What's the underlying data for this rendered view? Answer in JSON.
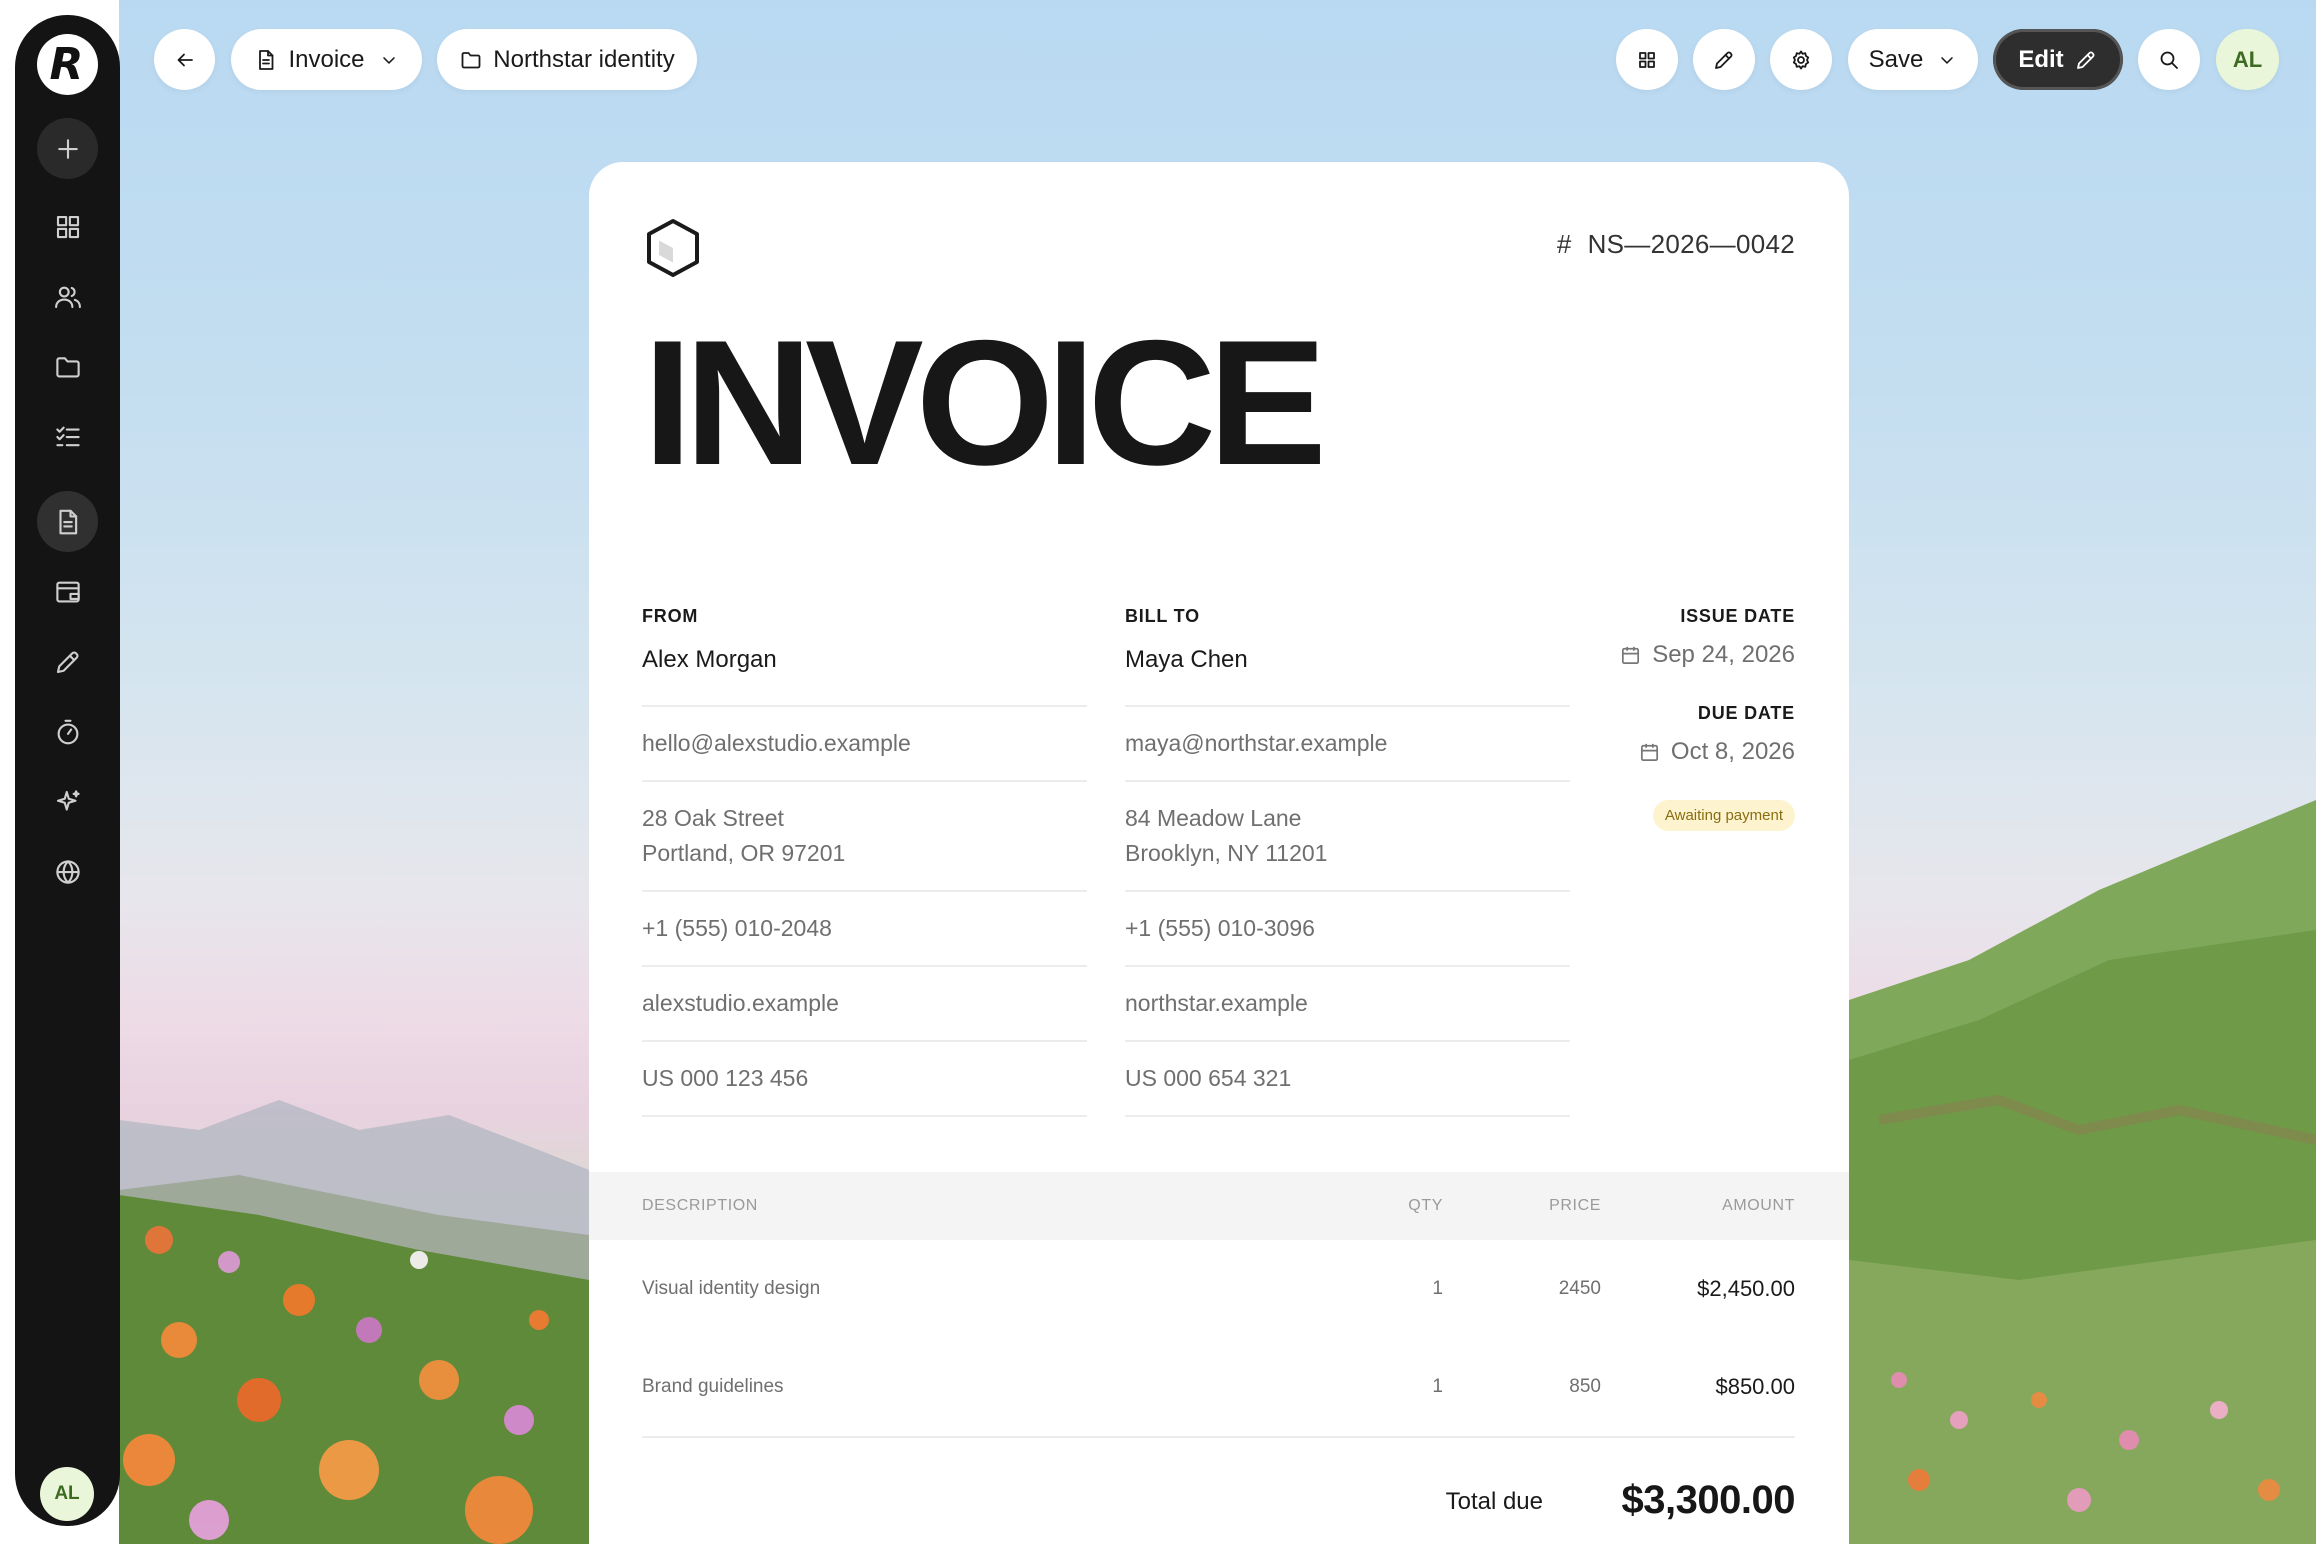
{
  "sidebar": {
    "logo_letter": "R",
    "avatar": "AL",
    "items": [
      {
        "icon": "plus-icon"
      },
      {
        "icon": "grid-icon"
      },
      {
        "icon": "users-icon"
      },
      {
        "icon": "folder-icon"
      },
      {
        "icon": "checklist-icon"
      },
      {
        "icon": "document-icon",
        "active": true
      },
      {
        "icon": "wallet-icon"
      },
      {
        "icon": "pencil-icon"
      },
      {
        "icon": "timer-icon"
      },
      {
        "icon": "sparkle-icon"
      },
      {
        "icon": "globe-icon"
      }
    ]
  },
  "topbar": {
    "doc_type": "Invoice",
    "project": "Northstar identity",
    "save_label": "Save",
    "edit_label": "Edit",
    "avatar": "AL"
  },
  "invoice": {
    "number_prefix": "#",
    "number": "NS—2026—0042",
    "title": "INVOICE",
    "from": {
      "label": "FROM",
      "name": "Alex Morgan",
      "email": "hello@alexstudio.example",
      "address_line1": "28 Oak Street",
      "address_line2": "Portland, OR 97201",
      "phone": "+1 (555) 010-2048",
      "website": "alexstudio.example",
      "tax_id": "US 000 123 456"
    },
    "bill_to": {
      "label": "BILL TO",
      "name": "Maya Chen",
      "email": "maya@northstar.example",
      "address_line1": "84 Meadow Lane",
      "address_line2": "Brooklyn, NY 11201",
      "phone": "+1 (555) 010-3096",
      "website": "northstar.example",
      "tax_id": "US 000 654 321"
    },
    "issue_date_label": "ISSUE DATE",
    "issue_date": "Sep 24, 2026",
    "due_date_label": "DUE DATE",
    "due_date": "Oct 8, 2026",
    "status": "Awaiting payment",
    "table": {
      "headers": {
        "description": "DESCRIPTION",
        "qty": "QTY",
        "price": "PRICE",
        "amount": "AMOUNT"
      },
      "rows": [
        {
          "description": "Visual identity design",
          "qty": "1",
          "price": "2450",
          "amount": "$2,450.00"
        },
        {
          "description": "Brand guidelines",
          "qty": "1",
          "price": "850",
          "amount": "$850.00"
        }
      ]
    },
    "total_label": "Total due",
    "total": "$3,300.00"
  },
  "colors": {
    "sidebar_bg": "#141414",
    "accent_avatar": "#e9f6d9",
    "badge_bg": "#fdf4cf",
    "badge_text": "#8a6d12"
  }
}
